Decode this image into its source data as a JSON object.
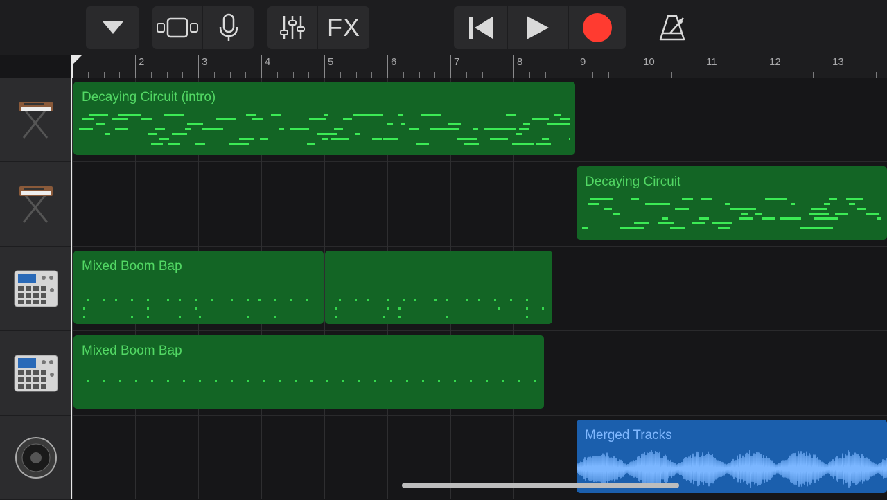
{
  "toolbar": {
    "fx_label": "FX",
    "icons": [
      "triangle-down-icon",
      "tracks-view-icon",
      "microphone-icon",
      "mixer-icon",
      "skip-back-icon",
      "play-icon",
      "record-icon",
      "metronome-icon"
    ],
    "record_color": "#ff3b30"
  },
  "ruler": {
    "bars": [
      "2",
      "3",
      "4",
      "5",
      "6",
      "7",
      "8",
      "9",
      "10",
      "11",
      "12",
      "13"
    ]
  },
  "tracks": [
    {
      "instrument_icon": "synth-keyboard-icon",
      "regions": [
        {
          "name": "Decaying Circuit (intro)",
          "type": "midi"
        }
      ]
    },
    {
      "instrument_icon": "synth-keyboard-icon",
      "regions": [
        {
          "name": "Decaying Circuit",
          "type": "midi"
        }
      ]
    },
    {
      "instrument_icon": "drum-machine-icon",
      "regions": [
        {
          "name": "Mixed Boom Bap",
          "type": "midi"
        },
        {
          "name": "",
          "type": "midi"
        }
      ]
    },
    {
      "instrument_icon": "drum-machine-icon",
      "regions": [
        {
          "name": "Mixed Boom Bap",
          "type": "midi"
        }
      ]
    },
    {
      "instrument_icon": "speaker-icon",
      "regions": [
        {
          "name": "Merged Tracks",
          "type": "audio"
        }
      ]
    }
  ],
  "colors": {
    "midi_region": "#136525",
    "audio_region": "#1b5fad",
    "midi_label": "#52d864",
    "audio_label": "#80b8ff"
  }
}
